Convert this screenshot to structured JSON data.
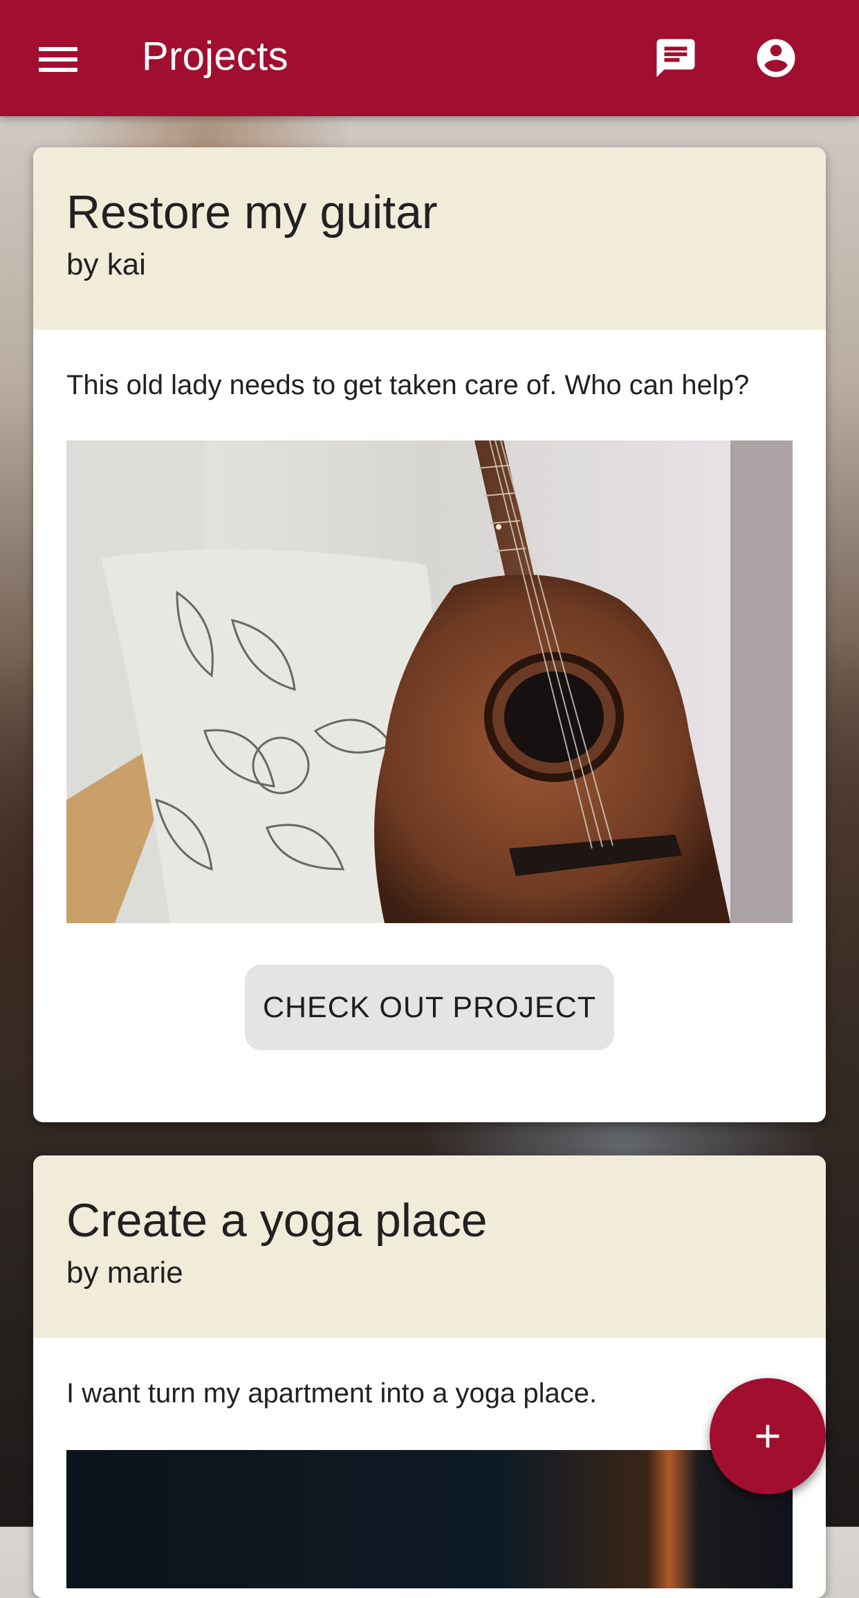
{
  "app_bar": {
    "title": "Projects",
    "menu_icon": "menu-icon",
    "chat_icon": "chat-icon",
    "account_icon": "account-circle-icon",
    "color": "#a10e2f"
  },
  "projects": [
    {
      "title": "Restore my guitar",
      "author": "by kai",
      "description": "This old lady needs to get taken care of. Who can help?",
      "image": "acoustic-guitar-photo",
      "action_label": "CHECK OUT PROJECT"
    },
    {
      "title": "Create a yoga place",
      "author": "by marie",
      "description": "I want turn my apartment into a yoga place.",
      "image": "dark-room-photo"
    }
  ],
  "fab": {
    "icon": "plus-icon",
    "color": "#a10e2f"
  },
  "colors": {
    "card_header": "#f1ecd9",
    "card_body": "#ffffff",
    "button": "#e4e4e4"
  }
}
